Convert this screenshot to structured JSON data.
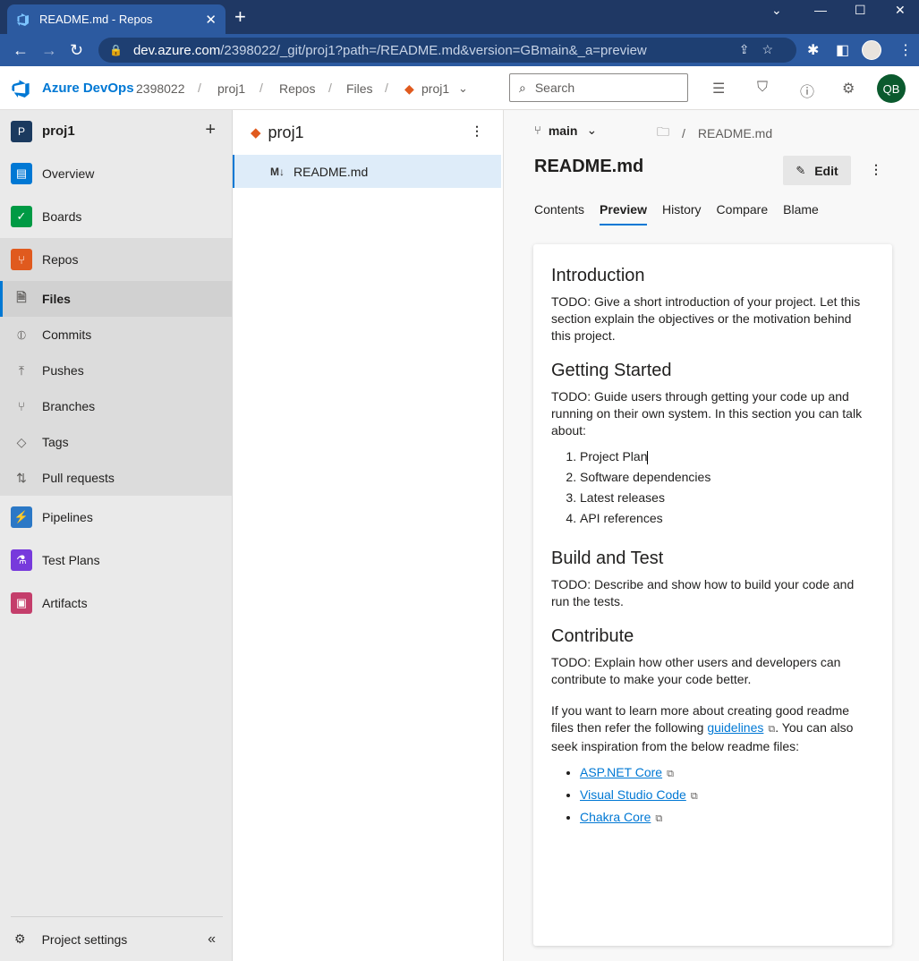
{
  "browser": {
    "tab_title": "README.md - Repos",
    "url_host": "dev.azure.com",
    "url_path": "/2398022/_git/proj1?path=/README.md&version=GBmain&_a=preview"
  },
  "header": {
    "app_name": "Azure DevOps",
    "breadcrumbs": [
      "2398022",
      "proj1",
      "Repos",
      "Files",
      "proj1"
    ],
    "search_placeholder": "Search",
    "avatar_initials": "QB"
  },
  "sidebar": {
    "project_initial": "P",
    "project_name": "proj1",
    "items": [
      {
        "label": "Overview",
        "icon": "overview-icon",
        "color": "#0078d4"
      },
      {
        "label": "Boards",
        "icon": "boards-icon",
        "color": "#009a44"
      },
      {
        "label": "Repos",
        "icon": "repos-icon",
        "color": "#e05a1e"
      }
    ],
    "repos_sub": [
      {
        "label": "Files",
        "icon": "files-icon"
      },
      {
        "label": "Commits",
        "icon": "commit-icon"
      },
      {
        "label": "Pushes",
        "icon": "push-icon"
      },
      {
        "label": "Branches",
        "icon": "branch-icon"
      },
      {
        "label": "Tags",
        "icon": "tag-icon"
      },
      {
        "label": "Pull requests",
        "icon": "pull-request-icon"
      }
    ],
    "items_after": [
      {
        "label": "Pipelines",
        "icon": "pipelines-icon",
        "color": "#2b78c6"
      },
      {
        "label": "Test Plans",
        "icon": "test-plans-icon",
        "color": "#773adc"
      },
      {
        "label": "Artifacts",
        "icon": "artifacts-icon",
        "color": "#c43e6b"
      }
    ],
    "settings_label": "Project settings"
  },
  "tree": {
    "repo_name": "proj1",
    "file_name": "README.md",
    "file_icon_text": "M↓"
  },
  "main": {
    "branch": "main",
    "path_file": "README.md",
    "title": "README.md",
    "edit_label": "Edit",
    "tabs": [
      "Contents",
      "Preview",
      "History",
      "Compare",
      "Blame"
    ],
    "active_tab": "Preview"
  },
  "readme": {
    "intro_heading": "Introduction",
    "intro_text": "TODO: Give a short introduction of your project. Let this section explain the objectives or the motivation behind this project.",
    "getting_started_heading": "Getting Started",
    "getting_started_text": "TODO: Guide users through getting your code up and running on their own system. In this section you can talk about:",
    "steps": [
      "Project Plan",
      "Software dependencies",
      "Latest releases",
      "API references"
    ],
    "build_heading": "Build and Test",
    "build_text": "TODO: Describe and show how to build your code and run the tests.",
    "contribute_heading": "Contribute",
    "contribute_text": "TODO: Explain how other users and developers can contribute to make your code better.",
    "learn_more_before": "If you want to learn more about creating good readme files then refer the following",
    "learn_more_link": "guidelines",
    "learn_more_after": ". You can also seek inspiration from the below readme files:",
    "links": [
      "ASP.NET Core",
      "Visual Studio Code",
      "Chakra Core"
    ]
  }
}
